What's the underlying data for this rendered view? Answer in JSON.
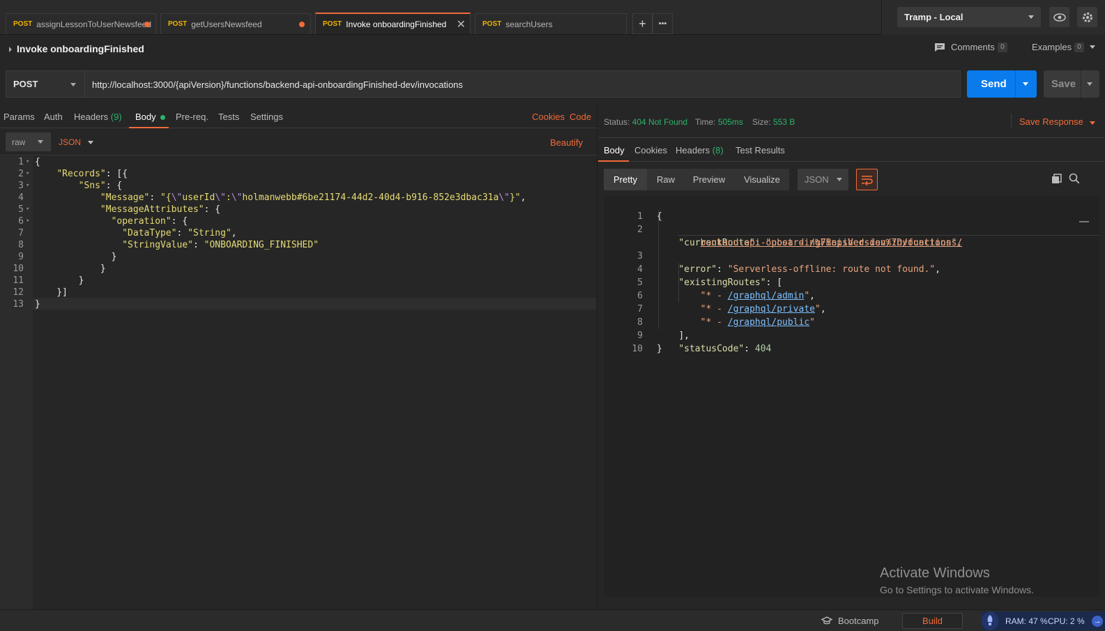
{
  "tabs": [
    {
      "method": "POST",
      "label": "assignLessonToUserNewsfeed",
      "unsaved": true
    },
    {
      "method": "POST",
      "label": "getUsersNewsfeed",
      "unsaved": true
    },
    {
      "method": "POST",
      "label": "Invoke onboardingFinished",
      "active": true
    },
    {
      "method": "POST",
      "label": "searchUsers"
    }
  ],
  "tab_actions": {
    "add": "+",
    "more": "•••"
  },
  "environment": {
    "selected": "Tramp - Local",
    "eye_icon": "eye-icon",
    "settings_icon": "gear-icon"
  },
  "request": {
    "title": "Invoke onboardingFinished",
    "comments_label": "Comments",
    "comments_count": "0",
    "examples_label": "Examples",
    "examples_count": "0",
    "method": "POST",
    "url": "http://localhost:3000/{apiVersion}/functions/backend-api-onboardingFinished-dev/invocations",
    "send_label": "Send",
    "save_label": "Save"
  },
  "request_tabs": {
    "params": "Params",
    "auth": "Auth",
    "headers": "Headers",
    "headers_count": "(9)",
    "body": "Body",
    "prereq": "Pre-req.",
    "tests": "Tests",
    "settings": "Settings",
    "cookies": "Cookies",
    "code": "Code"
  },
  "body_toolbar": {
    "mode": "raw",
    "format": "JSON",
    "beautify": "Beautify"
  },
  "request_body_lines": [
    "{",
    "    \"Records\": [{",
    "        \"Sns\": {",
    "            \"Message\": \"{\\\"userId\\\":\\\"holmanwebb#6be21174-44d2-40d4-b916-852e3dbac31a\\\"}\",",
    "            \"MessageAttributes\": {",
    "              \"operation\": {",
    "                \"DataType\": \"String\",",
    "                \"StringValue\": \"ONBOARDING_FINISHED\"",
    "              }",
    "            }",
    "        }",
    "    }]",
    "}"
  ],
  "response_status": {
    "status_label": "Status:",
    "status_value": "404 Not Found",
    "time_label": "Time:",
    "time_value": "505ms",
    "size_label": "Size:",
    "size_value": "553 B",
    "save_response": "Save Response"
  },
  "response_tabs": {
    "body": "Body",
    "cookies": "Cookies",
    "headers": "Headers",
    "headers_count": "(8)",
    "test_results": "Test Results"
  },
  "response_view": {
    "pretty": "Pretty",
    "raw": "Raw",
    "preview": "Preview",
    "visualize": "Visualize",
    "format": "JSON"
  },
  "response_body": {
    "l1": "{",
    "current_route_key": "\"currentRoute\"",
    "current_route_prefix": "\"post - ",
    "current_route_link1": "/%7BapiVersion%7D/functions/",
    "current_route_link2": "backend-api-onboardingFinished-dev/invocations",
    "current_route_suffix": "\",",
    "error_key": "\"error\"",
    "error_value": "\"Serverless-offline: route not found.\"",
    "existing_key": "\"existingRoutes\"",
    "route_prefix": "\"* - ",
    "routes": [
      "/graphql/admin",
      "/graphql/private",
      "/graphql/public"
    ],
    "close_bracket": "],",
    "status_key": "\"statusCode\"",
    "status_value": "404",
    "l10": "}"
  },
  "watermark": {
    "title": "Activate Windows",
    "subtitle": "Go to Settings to activate Windows."
  },
  "bottom_bar": {
    "bootcamp": "Bootcamp",
    "build": "Build",
    "ram": "RAM: 47 %",
    "cpu": "CPU: 2 %"
  }
}
